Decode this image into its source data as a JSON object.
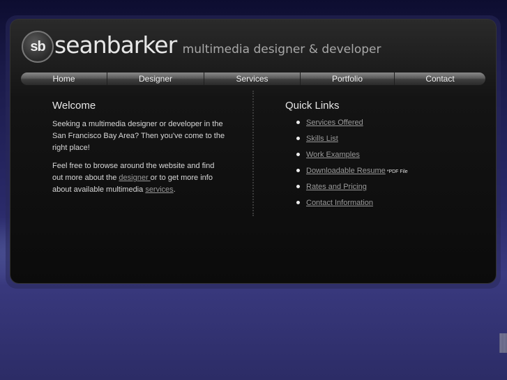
{
  "brand": {
    "logo_text": "sb",
    "name": "seanbarker",
    "tagline": "multimedia designer & developer"
  },
  "nav": [
    {
      "label": "Home"
    },
    {
      "label": "Designer"
    },
    {
      "label": "Services"
    },
    {
      "label": "Portfolio"
    },
    {
      "label": "Contact"
    }
  ],
  "welcome": {
    "title": "Welcome",
    "p1": "Seeking a multimedia designer or developer in the San Francisco Bay Area? Then you've come to the right place!",
    "p2_a": "Feel free to browse around the website and find out more about the ",
    "p2_link1": "designer ",
    "p2_b": "or to get more info about available multimedia ",
    "p2_link2": "services",
    "p2_c": "."
  },
  "quick_links": {
    "title": "Quick Links",
    "items": [
      {
        "label": "Services Offered"
      },
      {
        "label": "Skills List"
      },
      {
        "label": "Work Examples"
      },
      {
        "label": "Downloadable Resume",
        "note": "*PDF File"
      },
      {
        "label": "Rates and Pricing"
      },
      {
        "label": "Contact Information"
      }
    ]
  }
}
